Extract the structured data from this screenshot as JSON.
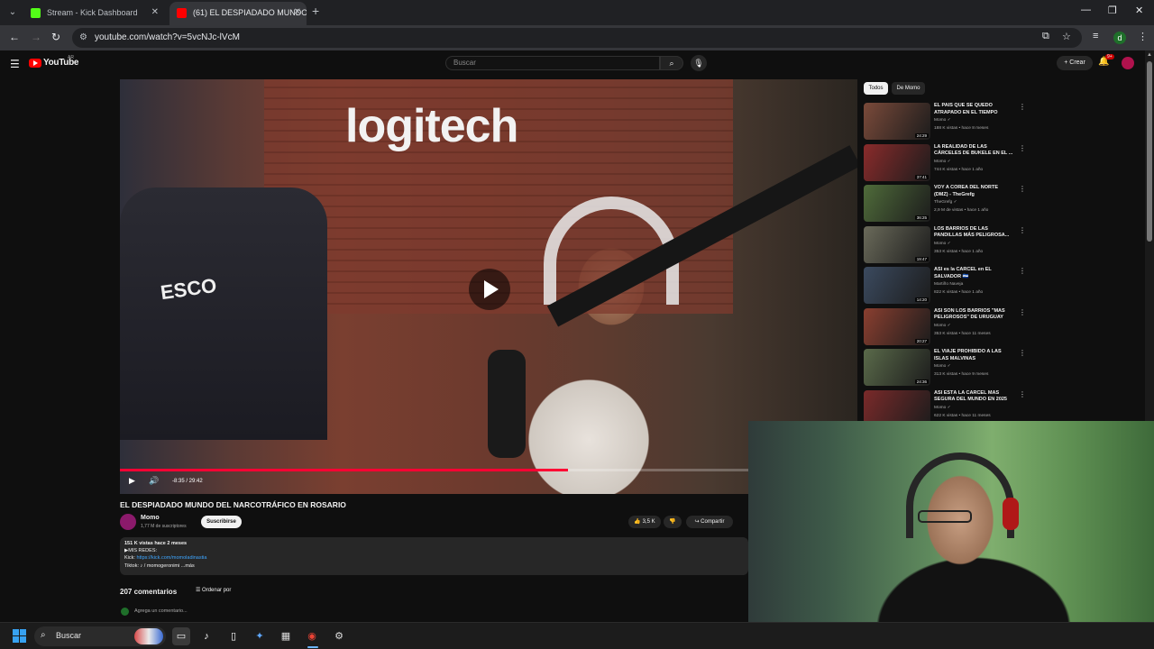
{
  "browser": {
    "tabs": [
      {
        "title": "Stream - Kick Dashboard",
        "fav_color": "#53fc18"
      },
      {
        "title": "(61) EL DESPIADADO MUNDO D",
        "fav_color": "#ff0000"
      }
    ],
    "url": "youtube.com/watch?v=5vcNJc-lVcM",
    "profile_initial": "d"
  },
  "youtube": {
    "logo_text": "YouTube",
    "logo_country": "AR",
    "search_placeholder": "Buscar",
    "create_label": "Crear",
    "notifications_count": "9+",
    "player": {
      "time": "-8:35 / 29:42",
      "progress_fraction": 0.71,
      "watermark_text": "logitech",
      "jersey_text": "ESCO"
    },
    "video_title": "EL DESPIADADO MUNDO DEL NARCOTRÁFICO EN ROSARIO",
    "channel": {
      "name": "Momo",
      "subscribers": "1,77 M de suscriptores",
      "subscribe_label": "Suscribirse"
    },
    "actions": {
      "likes": "3,5 K",
      "share_label": "Compartir"
    },
    "description": {
      "stats": "151 K vistas  hace 2 meses",
      "line1": "▶MIS REDES:",
      "kick_label": "Kick: ",
      "kick_link": "https://kick.com/momoladinastia",
      "tiktok": "Tiktok:  ♪ / momogeronimi  ...más"
    },
    "comments": {
      "count_label": "207 comentarios",
      "sort_label": "Ordenar por",
      "add_placeholder": "Agrega un comentario..."
    },
    "chips": [
      "Todos",
      "De Momo"
    ],
    "recommendations": [
      {
        "title": "EL PAÍS QUE SE QUEDÓ ATRAPADO EN EL TIEMPO",
        "channel": "Momo ✓",
        "meta": "188 K vistas • hace 8 meses",
        "duration": "24:29",
        "thumb": "#7a4a3a"
      },
      {
        "title": "LA REALIDAD DE LAS CÁRCELES DE BUKELE EN EL ...",
        "channel": "Momo ✓",
        "meta": "744 K vistas • hace 1 año",
        "duration": "37:41",
        "thumb": "#8a2b2b"
      },
      {
        "title": "VOY A COREA DEL NORTE (DMZ) - TheGrefg",
        "channel": "TheGrefg ✓",
        "meta": "2,9 M de vistas • hace 1 año",
        "duration": "36:25",
        "thumb": "#4f6b3a"
      },
      {
        "title": "LOS BARRIOS DE LAS PANDILLAS MÁS PELIGROSA...",
        "channel": "Momo ✓",
        "meta": "353 K vistas • hace 1 año",
        "duration": "19:47",
        "thumb": "#6a6a5a"
      },
      {
        "title": "ASÍ es la CÁRCEL en EL SALVADOR 🇸🇻",
        "channel": "Martiño Naveja",
        "meta": "822 K vistas • hace 1 año",
        "duration": "14:20",
        "thumb": "#3b4a5f"
      },
      {
        "title": "ASÍ SON LOS BARRIOS \"MÁS PELIGROSOS\" DE URUGUAY",
        "channel": "Momo ✓",
        "meta": "353 K vistas • hace 11 meses",
        "duration": "20:27",
        "thumb": "#8a3f30"
      },
      {
        "title": "EL VIAJE PROHIBIDO A LAS ISLAS MALVINAS",
        "channel": "Momo ✓",
        "meta": "313 K vistas • hace 9 meses",
        "duration": "24:36",
        "thumb": "#5a6a4a"
      },
      {
        "title": "ASÍ ESTÁ LA CÁRCEL MÁS SEGURA DEL MUNDO EN 2025",
        "channel": "Momo ✓",
        "meta": "622 K vistas • hace 11 meses",
        "duration": "",
        "thumb": "#7a2a2a"
      }
    ]
  },
  "taskbar": {
    "search_label": "Buscar"
  },
  "colors": {
    "accent_red": "#ff0033",
    "link_blue": "#3ea6ff",
    "bg": "#0f0f0f"
  }
}
